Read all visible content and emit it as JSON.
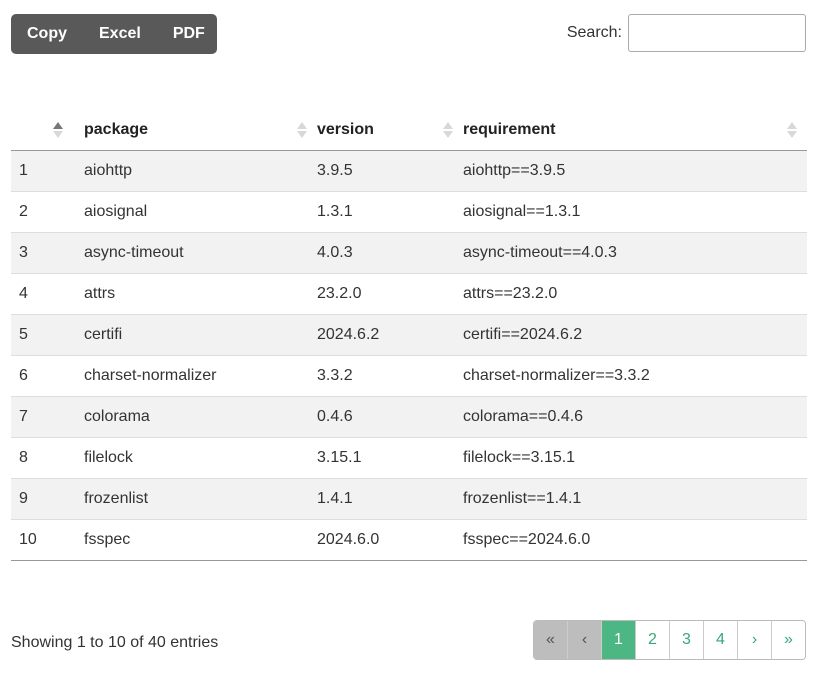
{
  "toolbar": {
    "buttons": [
      {
        "label": "Copy"
      },
      {
        "label": "Excel"
      },
      {
        "label": "PDF"
      }
    ]
  },
  "search": {
    "label": "Search:",
    "value": ""
  },
  "table": {
    "columns": [
      "",
      "package",
      "version",
      "requirement"
    ],
    "sort": {
      "column": 0,
      "direction": "asc"
    },
    "rows": [
      [
        "1",
        "aiohttp",
        "3.9.5",
        "aiohttp==3.9.5"
      ],
      [
        "2",
        "aiosignal",
        "1.3.1",
        "aiosignal==1.3.1"
      ],
      [
        "3",
        "async-timeout",
        "4.0.3",
        "async-timeout==4.0.3"
      ],
      [
        "4",
        "attrs",
        "23.2.0",
        "attrs==23.2.0"
      ],
      [
        "5",
        "certifi",
        "2024.6.2",
        "certifi==2024.6.2"
      ],
      [
        "6",
        "charset-normalizer",
        "3.3.2",
        "charset-normalizer==3.3.2"
      ],
      [
        "7",
        "colorama",
        "0.4.6",
        "colorama==0.4.6"
      ],
      [
        "8",
        "filelock",
        "3.15.1",
        "filelock==3.15.1"
      ],
      [
        "9",
        "frozenlist",
        "1.4.1",
        "frozenlist==1.4.1"
      ],
      [
        "10",
        "fsspec",
        "2024.6.0",
        "fsspec==2024.6.0"
      ]
    ]
  },
  "info": "Showing 1 to 10 of 40 entries",
  "pagination": {
    "first": "«",
    "previous": "‹",
    "pages": [
      "1",
      "2",
      "3",
      "4"
    ],
    "current": "1",
    "next": "›",
    "last": "»"
  },
  "colors": {
    "accent": "#4cb783",
    "toolbar_bg": "#595959"
  }
}
